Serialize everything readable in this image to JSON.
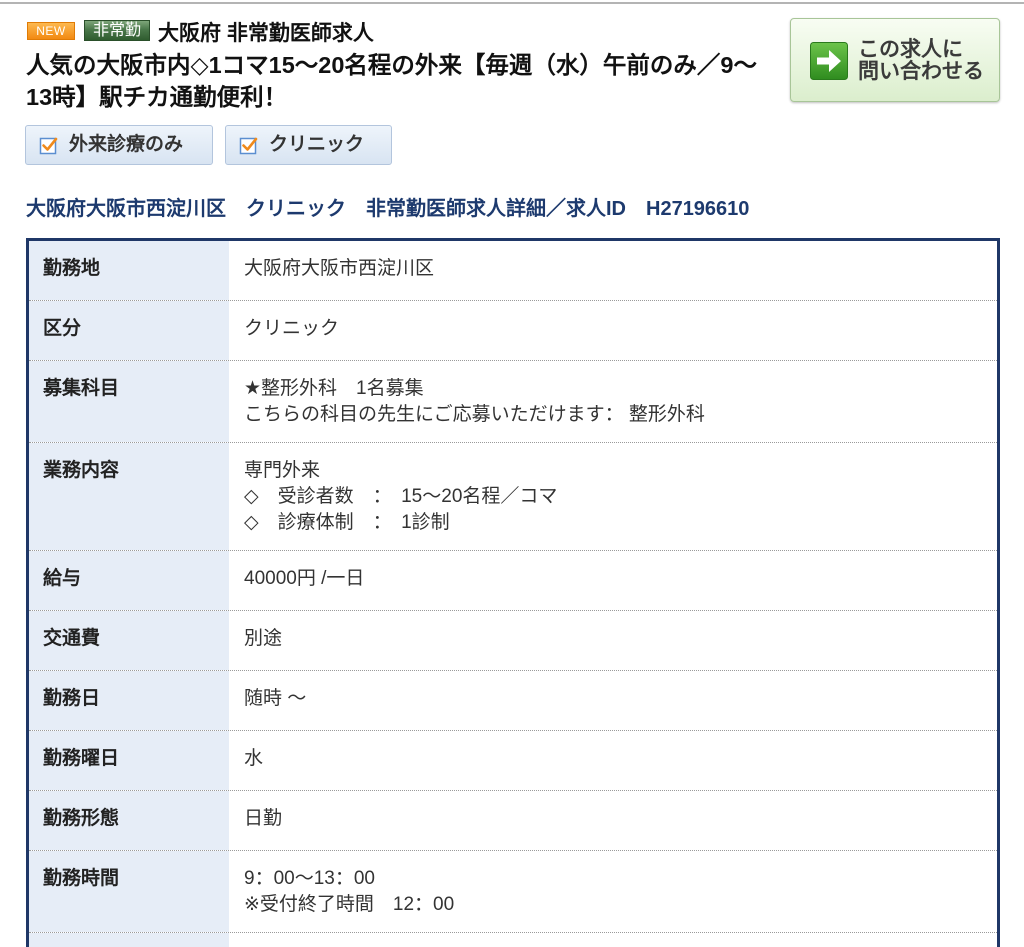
{
  "header": {
    "badges": {
      "new": "NEW",
      "type": "非常勤"
    },
    "category": "大阪府 非常勤医師求人",
    "title": "人気の大阪市内◇1コマ15〜20名程の外来【毎週（水）午前のみ／9〜13時】駅チカ通勤便利！",
    "inquiry_button": {
      "icon": "arrow-right-icon",
      "line1": "この求人に",
      "line2": "問い合わせる"
    }
  },
  "tags": [
    {
      "label": "外来診療のみ",
      "icon": "checkbox-icon"
    },
    {
      "label": "クリニック",
      "icon": "checkbox-icon"
    }
  ],
  "detail_heading": "大阪府大阪市西淀川区　クリニック　非常勤医師求人詳細／求人ID　H27196610",
  "details": [
    {
      "label": "勤務地",
      "lines": [
        "大阪府大阪市西淀川区"
      ]
    },
    {
      "label": "区分",
      "lines": [
        "クリニック"
      ]
    },
    {
      "label": "募集科目",
      "lines": [
        "★整形外科　1名募集",
        "こちらの科目の先生にご応募いただけます： 整形外科"
      ]
    },
    {
      "label": "業務内容",
      "lines": [
        "専門外来",
        "◇　受診者数　：　15〜20名程／コマ",
        "◇　診療体制　：　1診制"
      ]
    },
    {
      "label": "給与",
      "lines": [
        "40000円 /一日"
      ]
    },
    {
      "label": "交通費",
      "lines": [
        "別途"
      ]
    },
    {
      "label": "勤務日",
      "lines": [
        "随時 〜"
      ]
    },
    {
      "label": "勤務曜日",
      "lines": [
        "水"
      ]
    },
    {
      "label": "勤務形態",
      "lines": [
        "日勤"
      ]
    },
    {
      "label": "勤務時間",
      "lines": [
        "9：00〜13：00",
        "※受付終了時間　12：00"
      ]
    }
  ],
  "colors": {
    "new_badge": "#f39a1e",
    "type_badge": "#3c6b3c",
    "heading": "#1d3a6e",
    "table_border": "#1f3767",
    "label_bg": "#e6edf7",
    "inquiry_icon": "#3f9f2a",
    "tag_check": "#f08a1c"
  }
}
